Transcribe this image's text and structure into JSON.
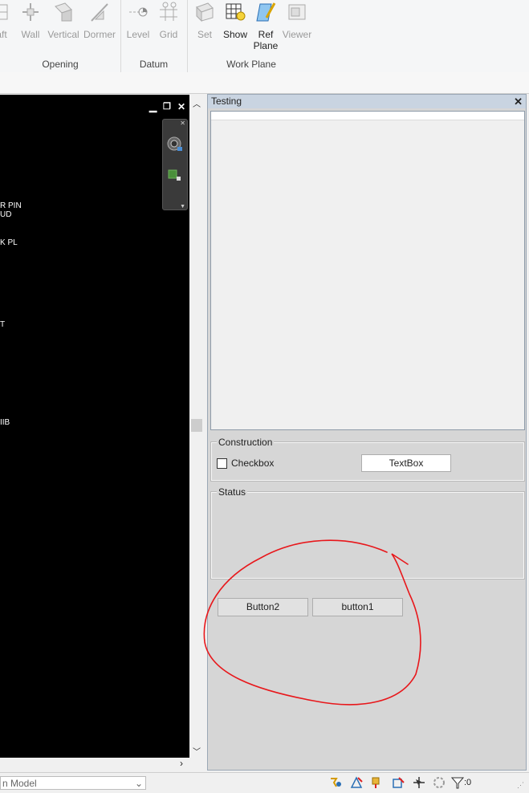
{
  "ribbon": {
    "groups": [
      {
        "title": "Opening",
        "buttons": [
          "aft",
          "Wall",
          "Vertical",
          "Dormer"
        ]
      },
      {
        "title": "Datum",
        "buttons": [
          "Level",
          "Grid"
        ]
      },
      {
        "title": "Work Plane",
        "buttons": [
          "Set",
          "Show",
          "Ref\nPlane",
          "Viewer"
        ]
      }
    ]
  },
  "view_labels": [
    "R PIN",
    "UD",
    "K PL",
    "T",
    "IIB"
  ],
  "palette": {
    "title": "Testing",
    "construction": {
      "legend": "Construction",
      "checkbox_label": "Checkbox",
      "textbox_value": "TextBox"
    },
    "status": {
      "legend": "Status"
    },
    "buttons": {
      "button2": "Button2",
      "button1": "button1"
    }
  },
  "statusbar": {
    "model_combo": "n Model",
    "filter_count": ":0"
  },
  "colors": {
    "annotation": "#e8171b",
    "palette_title": "#c9d4e1"
  }
}
